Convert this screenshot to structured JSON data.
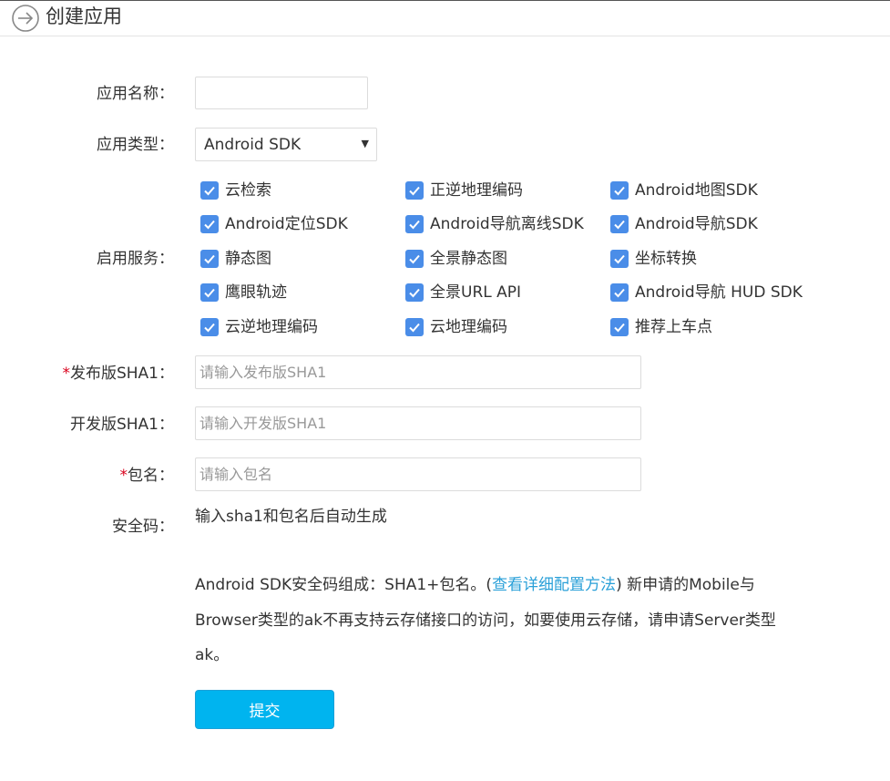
{
  "header": {
    "title": "创建应用",
    "back_icon": "arrow-right-circle-icon"
  },
  "form": {
    "app_name": {
      "label": "应用名称：",
      "value": "",
      "placeholder": ""
    },
    "app_type": {
      "label": "应用类型：",
      "selected": "Android SDK",
      "caret": "▼"
    },
    "services": {
      "label": "启用服务：",
      "checkbox_color": "#4a8de8",
      "items": [
        {
          "label": "云检索",
          "checked": true
        },
        {
          "label": "正逆地理编码",
          "checked": true
        },
        {
          "label": "Android地图SDK",
          "checked": true
        },
        {
          "label": "Android定位SDK",
          "checked": true
        },
        {
          "label": "Android导航离线SDK",
          "checked": true
        },
        {
          "label": "Android导航SDK",
          "checked": true
        },
        {
          "label": "静态图",
          "checked": true
        },
        {
          "label": "全景静态图",
          "checked": true
        },
        {
          "label": "坐标转换",
          "checked": true
        },
        {
          "label": "鹰眼轨迹",
          "checked": true
        },
        {
          "label": "全景URL API",
          "checked": true
        },
        {
          "label": "Android导航 HUD SDK",
          "checked": true
        },
        {
          "label": "云逆地理编码",
          "checked": true
        },
        {
          "label": "云地理编码",
          "checked": true
        },
        {
          "label": "推荐上车点",
          "checked": true
        }
      ]
    },
    "release_sha1": {
      "required_mark": "*",
      "label": "发布版SHA1：",
      "placeholder": "请输入发布版SHA1",
      "value": ""
    },
    "dev_sha1": {
      "label": "开发版SHA1：",
      "placeholder": "请输入开发版SHA1",
      "value": ""
    },
    "package": {
      "required_mark": "*",
      "label": "包名：",
      "placeholder": "请输入包名",
      "value": ""
    },
    "security_code": {
      "label": "安全码：",
      "value": "输入sha1和包名后自动生成"
    }
  },
  "notice": {
    "text_before": "Android SDK安全码组成：SHA1+包名。(",
    "link": "查看详细配置方法",
    "text_after": ") 新申请的Mobile与Browser类型的ak不再支持云存储接口的访问，如要使用云存储，请申请Server类型ak。"
  },
  "submit": {
    "label": "提交",
    "color": "#00b4ef"
  }
}
